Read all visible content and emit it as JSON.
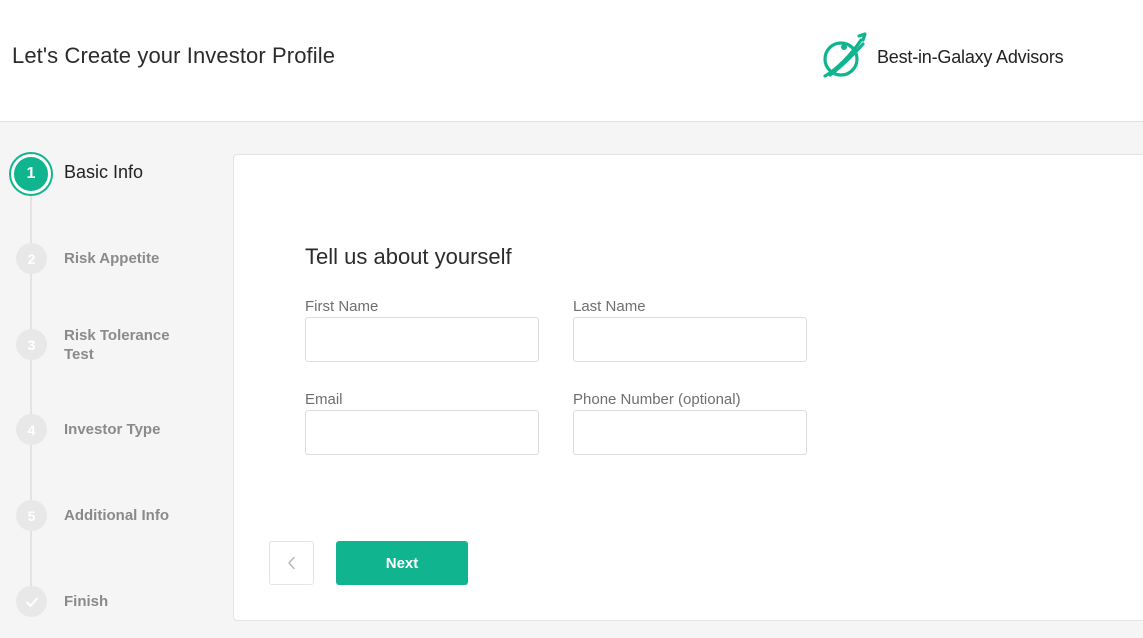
{
  "header": {
    "title": "Let's Create your Investor Profile",
    "brand_name": "Best-in-Galaxy Advisors",
    "brand_icon": "planet-rocket-logo",
    "brand_color": "#10b48f"
  },
  "stepper": {
    "active_step": 1,
    "steps": [
      {
        "number": "1",
        "label": "Basic Info",
        "state": "active"
      },
      {
        "number": "2",
        "label": "Risk Appetite",
        "state": "pending"
      },
      {
        "number": "3",
        "label": "Risk Tolerance Test",
        "state": "pending"
      },
      {
        "number": "4",
        "label": "Investor Type",
        "state": "pending"
      },
      {
        "number": "5",
        "label": "Additional Info",
        "state": "pending"
      },
      {
        "number": "",
        "icon": "check-icon",
        "label": "Finish",
        "state": "pending"
      }
    ]
  },
  "form": {
    "heading": "Tell us about yourself",
    "fields": {
      "first_name": {
        "label": "First Name",
        "value": "",
        "placeholder": ""
      },
      "last_name": {
        "label": "Last Name",
        "value": "",
        "placeholder": ""
      },
      "email": {
        "label": "Email",
        "value": "",
        "placeholder": ""
      },
      "phone": {
        "label": "Phone Number (optional)",
        "value": "",
        "placeholder": ""
      }
    },
    "back_icon": "chevron-left-icon",
    "next_label": "Next"
  },
  "colors": {
    "accent": "#10b48f",
    "inactive_step": "#e8e8e8",
    "background": "#f5f5f5"
  }
}
